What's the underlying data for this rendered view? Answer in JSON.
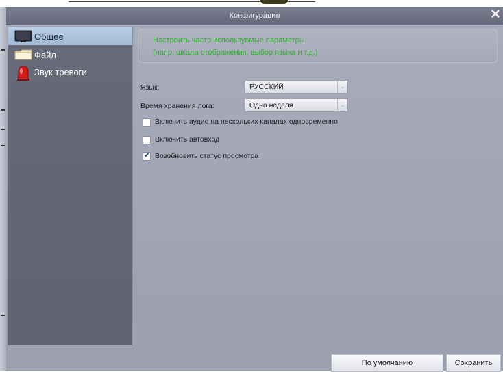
{
  "dialog": {
    "title": "Конфигурация",
    "close_glyph": "✕"
  },
  "sidebar": {
    "items": [
      {
        "label": "Общее",
        "icon": "monitor-icon",
        "active": true
      },
      {
        "label": "Файл",
        "icon": "folder-icon",
        "active": false
      },
      {
        "label": "Звук тревоги",
        "icon": "alarm-icon",
        "active": false
      }
    ]
  },
  "general": {
    "hint_line1": "Настроить часто используемые параметры",
    "hint_line2": "(напр. шкала отображения, выбор языка и т.д.)",
    "language_label": "Язык:",
    "language_value": "РУССКИЙ",
    "log_label": "Время хранения лога:",
    "log_value": "Одна неделя",
    "checkboxes": [
      {
        "label": "Включить аудио на нескольких каналах одновременно",
        "checked": false
      },
      {
        "label": "Включить автовход",
        "checked": false
      },
      {
        "label": "Возобновить статус просмотра",
        "checked": true
      }
    ]
  },
  "buttons": {
    "default_label": "По умолчанию",
    "save_label": "Сохранить"
  },
  "colors": {
    "hint_text": "#2fb02f",
    "active_item": "#b9cde4",
    "sidebar_bg": "#676a79"
  }
}
